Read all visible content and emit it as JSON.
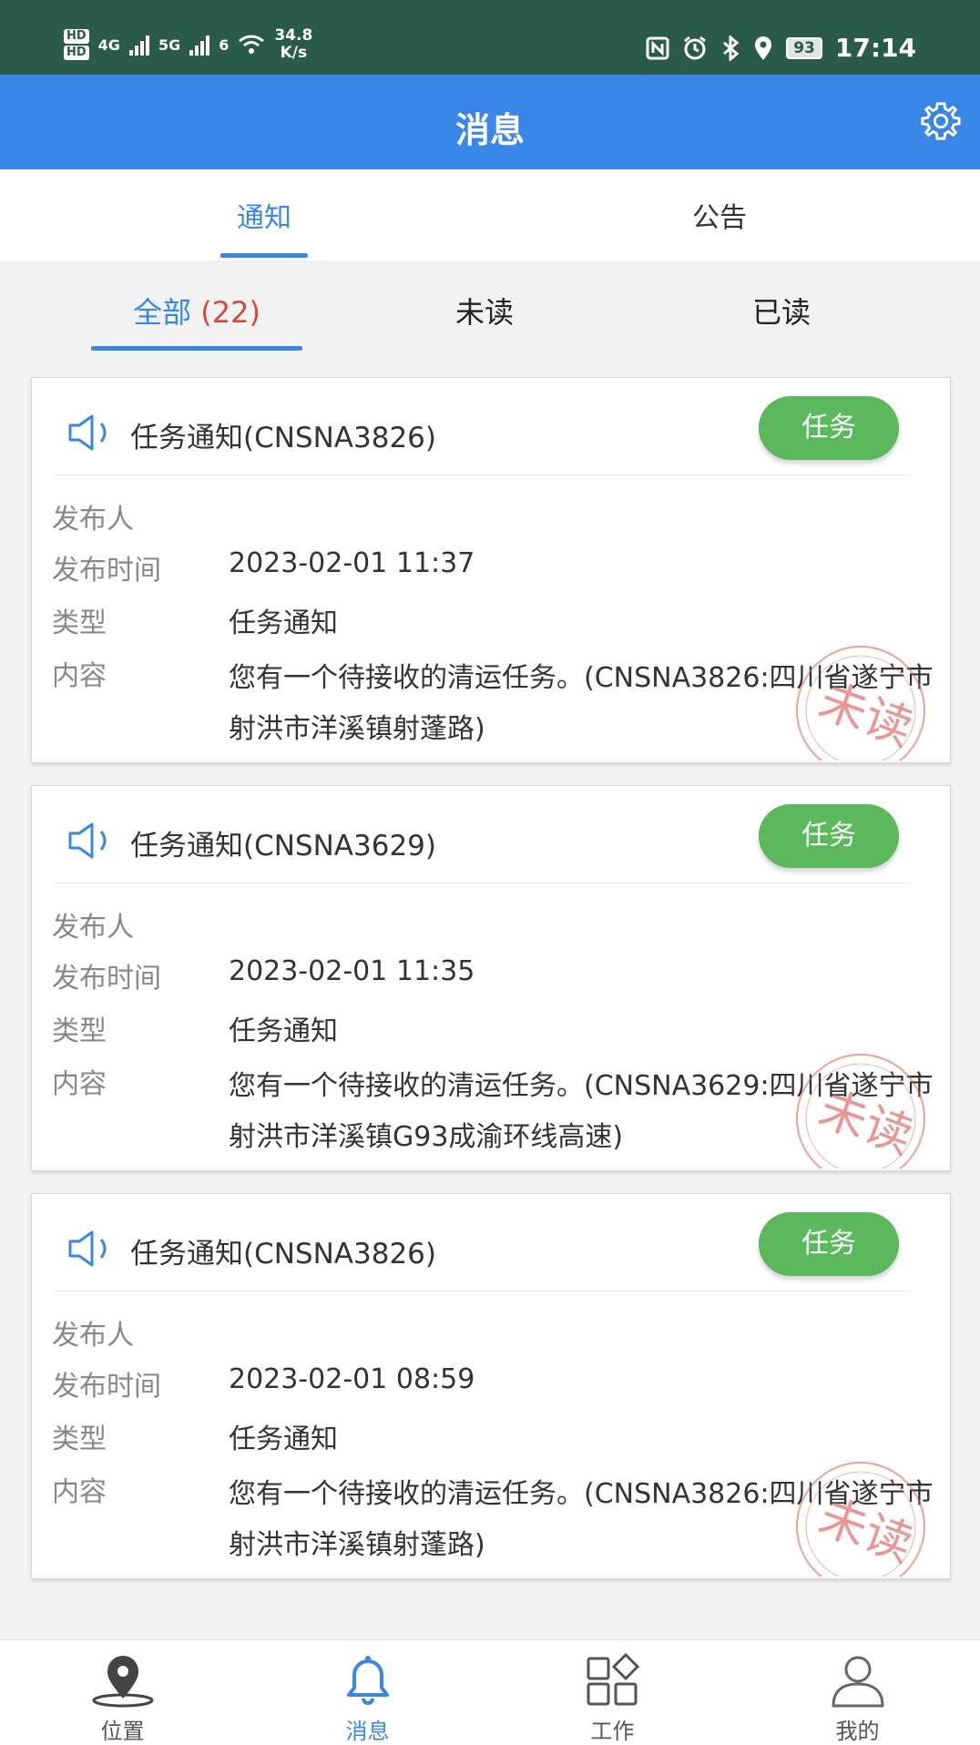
{
  "status_bar": {
    "hd1": "HD",
    "hd2": "HD",
    "net1": "4G",
    "net2": "5G",
    "wifi_sup": "6",
    "speed_value": "34.8",
    "speed_unit": "K/s",
    "battery": "93",
    "time": "17:14"
  },
  "app_bar": {
    "title": "消息",
    "settings_icon": "gear-icon"
  },
  "top_tabs": [
    {
      "label": "通知",
      "active": true
    },
    {
      "label": "公告",
      "active": false
    }
  ],
  "sub_tabs": {
    "all_label": "全部",
    "all_count": "(22)",
    "unread_label": "未读",
    "read_label": "已读"
  },
  "field_labels": {
    "publisher": "发布人",
    "time": "发布时间",
    "type": "类型",
    "content": "内容"
  },
  "stamp_text": "未读",
  "messages": [
    {
      "title": "任务通知(CNSNA3826)",
      "badge": "任务",
      "publisher": "",
      "time": "2023-02-01 11:37",
      "type": "任务通知",
      "content": "您有一个待接收的清运任务。(CNSNA3826:四川省遂宁市射洪市洋溪镇射蓬路)"
    },
    {
      "title": "任务通知(CNSNA3629)",
      "badge": "任务",
      "publisher": "",
      "time": "2023-02-01 11:35",
      "type": "任务通知",
      "content": "您有一个待接收的清运任务。(CNSNA3629:四川省遂宁市射洪市洋溪镇G93成渝环线高速)"
    },
    {
      "title": "任务通知(CNSNA3826)",
      "badge": "任务",
      "publisher": "",
      "time": "2023-02-01 08:59",
      "type": "任务通知",
      "content": "您有一个待接收的清运任务。(CNSNA3826:四川省遂宁市射洪市洋溪镇射蓬路)"
    }
  ],
  "bottom_nav": [
    {
      "label": "位置",
      "icon": "location-pin-icon",
      "active": false
    },
    {
      "label": "消息",
      "icon": "bell-icon",
      "active": true
    },
    {
      "label": "工作",
      "icon": "grid-apps-icon",
      "active": false
    },
    {
      "label": "我的",
      "icon": "user-icon",
      "active": false
    }
  ],
  "colors": {
    "primary": "#3a86e8",
    "status_bar": "#2a5a4a",
    "badge_green": "#5cb85c",
    "count_red": "#d24a3a",
    "stamp_red": "#d9534f"
  }
}
